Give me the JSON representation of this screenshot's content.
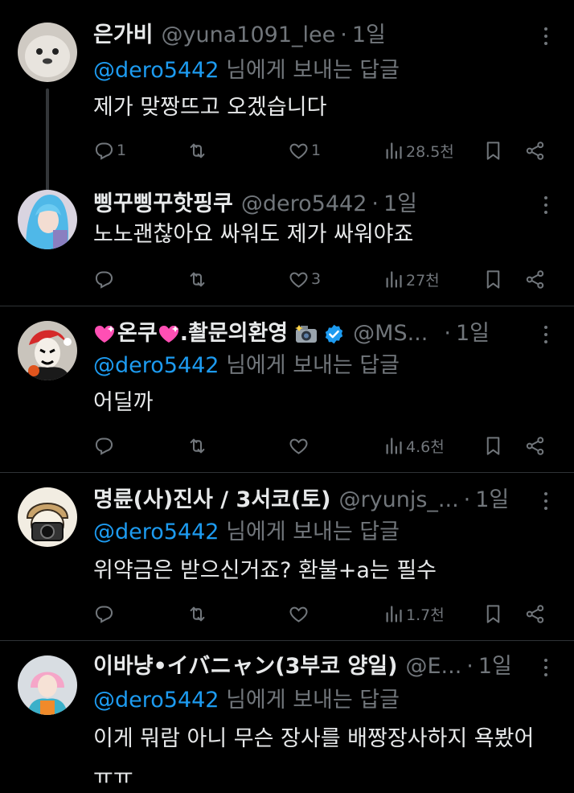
{
  "posts": [
    {
      "name": "은가비",
      "handle": "@yuna1091_lee",
      "time": "1일",
      "reply_prefix": "",
      "reply_mention": "@dero5442",
      "reply_suffix": "님에게 보내는 답글",
      "text": "제가 맞짱뜨고 오겠습니다",
      "replies": "1",
      "reposts": "",
      "likes": "1",
      "views": "28.5천"
    },
    {
      "name": "삥꾸삥꾸핫핑쿠",
      "handle": "@dero5442",
      "time": "1일",
      "text": "노노괜찮아요 싸워도 제가 싸워야죠",
      "replies": "",
      "reposts": "",
      "likes": "3",
      "views": "27천"
    },
    {
      "name": ".촬문의환영",
      "name_prefix": "온쿠",
      "handle": "@MS...",
      "time": "1일",
      "reply_mention": "@dero5442",
      "reply_suffix": "님에게 보내는 답글",
      "text": "어딜까",
      "replies": "",
      "reposts": "",
      "likes": "",
      "views": "4.6천"
    },
    {
      "name": "명륜(사)진사 / 3서코(토)",
      "handle": "@ryunjs_...",
      "time": "1일",
      "reply_mention": "@dero5442",
      "reply_suffix": "님에게 보내는 답글",
      "text": "위약금은 받으신거죠? 환불+a는 필수",
      "replies": "",
      "reposts": "",
      "likes": "",
      "views": "1.7천"
    },
    {
      "name": "이바냥•イバニャン(3부코 양일)",
      "handle": "@E...",
      "time": "1일",
      "reply_mention": "@dero5442",
      "reply_suffix": "님에게 보내는 답글",
      "text": "이게 뭐람 아니 무슨 장사를 배짱장사하지 욕봤어",
      "text2": "ㅠㅠ"
    }
  ],
  "colors": {
    "background": "#000000",
    "text": "#e7e9ea",
    "muted": "#71767b",
    "mention": "#1d9bf0",
    "divider": "#2f3336",
    "verified": "#1d9bf0"
  },
  "icons": [
    "reply-icon",
    "repost-icon",
    "like-icon",
    "views-icon",
    "bookmark-icon",
    "share-icon",
    "more-icon",
    "verified-badge-icon",
    "camera-emoji-icon",
    "heart-emoji-icon"
  ]
}
